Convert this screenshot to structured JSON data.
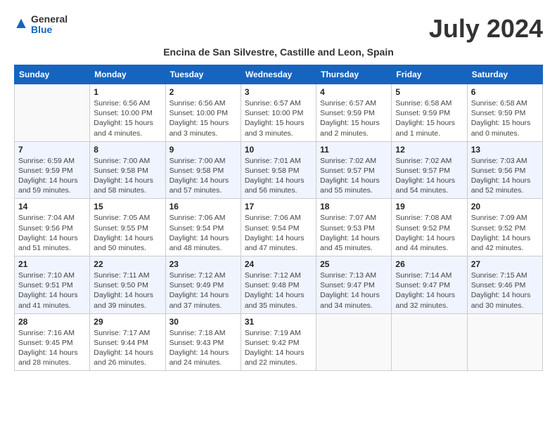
{
  "header": {
    "logo_general": "General",
    "logo_blue": "Blue",
    "month_year": "July 2024",
    "subtitle": "Encina de San Silvestre, Castille and Leon, Spain"
  },
  "columns": [
    "Sunday",
    "Monday",
    "Tuesday",
    "Wednesday",
    "Thursday",
    "Friday",
    "Saturday"
  ],
  "weeks": [
    [
      {
        "day": "",
        "sunrise": "",
        "sunset": "",
        "daylight": "",
        "empty": true
      },
      {
        "day": "1",
        "sunrise": "Sunrise: 6:56 AM",
        "sunset": "Sunset: 10:00 PM",
        "daylight": "Daylight: 15 hours and 4 minutes."
      },
      {
        "day": "2",
        "sunrise": "Sunrise: 6:56 AM",
        "sunset": "Sunset: 10:00 PM",
        "daylight": "Daylight: 15 hours and 3 minutes."
      },
      {
        "day": "3",
        "sunrise": "Sunrise: 6:57 AM",
        "sunset": "Sunset: 10:00 PM",
        "daylight": "Daylight: 15 hours and 3 minutes."
      },
      {
        "day": "4",
        "sunrise": "Sunrise: 6:57 AM",
        "sunset": "Sunset: 9:59 PM",
        "daylight": "Daylight: 15 hours and 2 minutes."
      },
      {
        "day": "5",
        "sunrise": "Sunrise: 6:58 AM",
        "sunset": "Sunset: 9:59 PM",
        "daylight": "Daylight: 15 hours and 1 minute."
      },
      {
        "day": "6",
        "sunrise": "Sunrise: 6:58 AM",
        "sunset": "Sunset: 9:59 PM",
        "daylight": "Daylight: 15 hours and 0 minutes."
      }
    ],
    [
      {
        "day": "7",
        "sunrise": "Sunrise: 6:59 AM",
        "sunset": "Sunset: 9:59 PM",
        "daylight": "Daylight: 14 hours and 59 minutes."
      },
      {
        "day": "8",
        "sunrise": "Sunrise: 7:00 AM",
        "sunset": "Sunset: 9:58 PM",
        "daylight": "Daylight: 14 hours and 58 minutes."
      },
      {
        "day": "9",
        "sunrise": "Sunrise: 7:00 AM",
        "sunset": "Sunset: 9:58 PM",
        "daylight": "Daylight: 14 hours and 57 minutes."
      },
      {
        "day": "10",
        "sunrise": "Sunrise: 7:01 AM",
        "sunset": "Sunset: 9:58 PM",
        "daylight": "Daylight: 14 hours and 56 minutes."
      },
      {
        "day": "11",
        "sunrise": "Sunrise: 7:02 AM",
        "sunset": "Sunset: 9:57 PM",
        "daylight": "Daylight: 14 hours and 55 minutes."
      },
      {
        "day": "12",
        "sunrise": "Sunrise: 7:02 AM",
        "sunset": "Sunset: 9:57 PM",
        "daylight": "Daylight: 14 hours and 54 minutes."
      },
      {
        "day": "13",
        "sunrise": "Sunrise: 7:03 AM",
        "sunset": "Sunset: 9:56 PM",
        "daylight": "Daylight: 14 hours and 52 minutes."
      }
    ],
    [
      {
        "day": "14",
        "sunrise": "Sunrise: 7:04 AM",
        "sunset": "Sunset: 9:56 PM",
        "daylight": "Daylight: 14 hours and 51 minutes."
      },
      {
        "day": "15",
        "sunrise": "Sunrise: 7:05 AM",
        "sunset": "Sunset: 9:55 PM",
        "daylight": "Daylight: 14 hours and 50 minutes."
      },
      {
        "day": "16",
        "sunrise": "Sunrise: 7:06 AM",
        "sunset": "Sunset: 9:54 PM",
        "daylight": "Daylight: 14 hours and 48 minutes."
      },
      {
        "day": "17",
        "sunrise": "Sunrise: 7:06 AM",
        "sunset": "Sunset: 9:54 PM",
        "daylight": "Daylight: 14 hours and 47 minutes."
      },
      {
        "day": "18",
        "sunrise": "Sunrise: 7:07 AM",
        "sunset": "Sunset: 9:53 PM",
        "daylight": "Daylight: 14 hours and 45 minutes."
      },
      {
        "day": "19",
        "sunrise": "Sunrise: 7:08 AM",
        "sunset": "Sunset: 9:52 PM",
        "daylight": "Daylight: 14 hours and 44 minutes."
      },
      {
        "day": "20",
        "sunrise": "Sunrise: 7:09 AM",
        "sunset": "Sunset: 9:52 PM",
        "daylight": "Daylight: 14 hours and 42 minutes."
      }
    ],
    [
      {
        "day": "21",
        "sunrise": "Sunrise: 7:10 AM",
        "sunset": "Sunset: 9:51 PM",
        "daylight": "Daylight: 14 hours and 41 minutes."
      },
      {
        "day": "22",
        "sunrise": "Sunrise: 7:11 AM",
        "sunset": "Sunset: 9:50 PM",
        "daylight": "Daylight: 14 hours and 39 minutes."
      },
      {
        "day": "23",
        "sunrise": "Sunrise: 7:12 AM",
        "sunset": "Sunset: 9:49 PM",
        "daylight": "Daylight: 14 hours and 37 minutes."
      },
      {
        "day": "24",
        "sunrise": "Sunrise: 7:12 AM",
        "sunset": "Sunset: 9:48 PM",
        "daylight": "Daylight: 14 hours and 35 minutes."
      },
      {
        "day": "25",
        "sunrise": "Sunrise: 7:13 AM",
        "sunset": "Sunset: 9:47 PM",
        "daylight": "Daylight: 14 hours and 34 minutes."
      },
      {
        "day": "26",
        "sunrise": "Sunrise: 7:14 AM",
        "sunset": "Sunset: 9:47 PM",
        "daylight": "Daylight: 14 hours and 32 minutes."
      },
      {
        "day": "27",
        "sunrise": "Sunrise: 7:15 AM",
        "sunset": "Sunset: 9:46 PM",
        "daylight": "Daylight: 14 hours and 30 minutes."
      }
    ],
    [
      {
        "day": "28",
        "sunrise": "Sunrise: 7:16 AM",
        "sunset": "Sunset: 9:45 PM",
        "daylight": "Daylight: 14 hours and 28 minutes."
      },
      {
        "day": "29",
        "sunrise": "Sunrise: 7:17 AM",
        "sunset": "Sunset: 9:44 PM",
        "daylight": "Daylight: 14 hours and 26 minutes."
      },
      {
        "day": "30",
        "sunrise": "Sunrise: 7:18 AM",
        "sunset": "Sunset: 9:43 PM",
        "daylight": "Daylight: 14 hours and 24 minutes."
      },
      {
        "day": "31",
        "sunrise": "Sunrise: 7:19 AM",
        "sunset": "Sunset: 9:42 PM",
        "daylight": "Daylight: 14 hours and 22 minutes."
      },
      {
        "day": "",
        "sunrise": "",
        "sunset": "",
        "daylight": "",
        "empty": true
      },
      {
        "day": "",
        "sunrise": "",
        "sunset": "",
        "daylight": "",
        "empty": true
      },
      {
        "day": "",
        "sunrise": "",
        "sunset": "",
        "daylight": "",
        "empty": true
      }
    ]
  ]
}
